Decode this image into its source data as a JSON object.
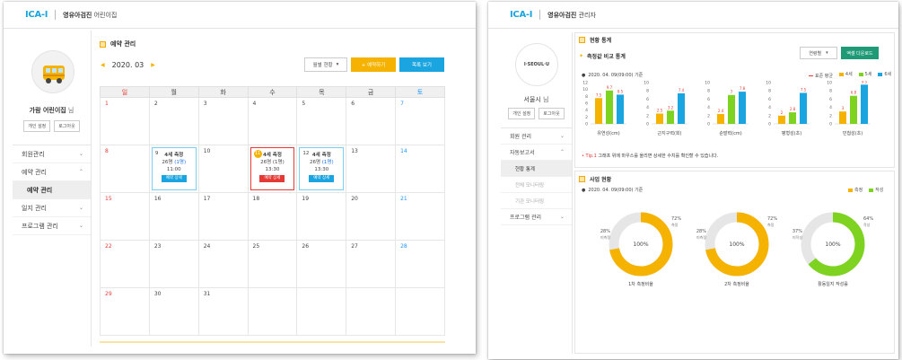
{
  "left": {
    "logo": "ICA-I",
    "title_bold": "영유아검진",
    "title_rest": " 어린이집",
    "profile": {
      "name": "가람 어린이집",
      "suffix": " 님",
      "btn1": "개인 설정",
      "btn2": "로그아웃"
    },
    "menu": [
      {
        "label": "회원관리",
        "chev": "⌄"
      },
      {
        "label": "예약 관리",
        "chev": "⌃"
      },
      {
        "label": "예약 관리",
        "chev": ""
      },
      {
        "label": "일지 관리",
        "chev": "⌄"
      },
      {
        "label": "프로그램 관리",
        "chev": "⌄"
      }
    ],
    "section_title": "예약 관리",
    "month": "2020. 03",
    "prev": "◀",
    "next": "▶",
    "select_label": "월별 현황",
    "reserve_btn": "+ 예약하기",
    "list_btn": "목록 보기",
    "weekdays": [
      "일",
      "월",
      "화",
      "수",
      "목",
      "금",
      "토"
    ],
    "weeks": [
      [
        "1",
        "2",
        "3",
        "4",
        "5",
        "6",
        "7"
      ],
      [
        "8",
        "9",
        "10",
        "11",
        "12",
        "13",
        "14"
      ],
      [
        "15",
        "16",
        "17",
        "18",
        "19",
        "20",
        "21"
      ],
      [
        "22",
        "23",
        "24",
        "25",
        "26",
        "27",
        "28"
      ],
      [
        "29",
        "30",
        "31",
        "",
        "",
        "",
        ""
      ]
    ],
    "events": {
      "e9": {
        "day": "9",
        "title": "4세 측정",
        "count_a": "26명 ",
        "count_b": "(1명)",
        "time": "11:00",
        "btn": "예약 상세"
      },
      "e11": {
        "day": "11",
        "title": "4세 측정",
        "count_a": "26명 (1명)",
        "count_b": "",
        "time": "13:30",
        "btn": "예약 상세"
      },
      "e12": {
        "day": "12",
        "title": "4세 측정",
        "count_a": "26명 ",
        "count_b": "(1명)",
        "time": "13:30",
        "btn": "예약 상세"
      }
    }
  },
  "right": {
    "logo": "ICA-I",
    "title_bold": "영유아검진",
    "title_rest": " 관리자",
    "profile": {
      "logo": "I·SEOUL·U",
      "name": "서울시",
      "suffix": " 님",
      "btn1": "개인 설정",
      "btn2": "로그아웃"
    },
    "menu": [
      {
        "label": "회원 관리",
        "chev": "⌄",
        "cls": ""
      },
      {
        "label": "자동보고서",
        "chev": "⌃",
        "cls": ""
      },
      {
        "label": "현황 통계",
        "chev": "",
        "cls": "sub"
      },
      {
        "label": "전체 모니터링",
        "chev": "",
        "cls": "sub2"
      },
      {
        "label": "기관 모니터링",
        "chev": "",
        "cls": "sub2"
      },
      {
        "label": "프로그램 관리",
        "chev": "⌄",
        "cls": ""
      }
    ],
    "section1": "현황 통계",
    "sub1": "측정값 비교 통계",
    "select1": "연령별",
    "excel_btn": "엑셀 다운로드",
    "date1": "2020. 04. 09(09:00) 기준",
    "legend": [
      "표준 평균",
      "4세",
      "5세",
      "6세"
    ],
    "tip_label": "Tip.1",
    "tip_text": "그래프 위에 마우스를 올리면 상세한 수치를 확인할 수 있습니다.",
    "section2": "사업 현황",
    "date2": "2020. 04. 09(09:00) 기준",
    "legend2": [
      "측정",
      "작성"
    ],
    "colors": {
      "std": "#e53935",
      "age4": "#f5b300",
      "age5": "#7ed321",
      "age6": "#1aa4e0",
      "excel": "#1f9a76",
      "accent": "#f5b300"
    }
  },
  "chart_data": [
    {
      "type": "bar",
      "title": "유연성(cm)",
      "categories": [
        "4세",
        "5세",
        "6세"
      ],
      "series": [
        {
          "name": "값",
          "values": [
            7.5,
            9.7,
            8.5
          ]
        }
      ],
      "ylim": [
        0,
        12
      ],
      "yticks": [
        "12",
        "10",
        "8",
        "6",
        "4",
        "2",
        "0"
      ]
    },
    {
      "type": "bar",
      "title": "근지구력(회)",
      "categories": [
        "4세",
        "5세",
        "6세"
      ],
      "series": [
        {
          "name": "값",
          "values": [
            2.5,
            3.2,
            7.4
          ]
        }
      ],
      "ylim": [
        0,
        10
      ],
      "yticks": [
        "10",
        "8",
        "6",
        "4",
        "2",
        "0"
      ]
    },
    {
      "type": "bar",
      "title": "순발력(cm)",
      "categories": [
        "4세",
        "5세",
        "6세"
      ],
      "series": [
        {
          "name": "값",
          "values": [
            2.4,
            7.0,
            7.8
          ]
        }
      ],
      "ylim": [
        0,
        10
      ],
      "yticks": [
        "10",
        "8",
        "6",
        "4",
        "2",
        "0"
      ]
    },
    {
      "type": "bar",
      "title": "평형성(초)",
      "categories": [
        "4세",
        "5세",
        "6세"
      ],
      "series": [
        {
          "name": "값",
          "values": [
            2.0,
            2.8,
            7.5
          ]
        }
      ],
      "ylim": [
        0,
        10
      ],
      "yticks": [
        "10",
        "8",
        "6",
        "4",
        "2",
        "0"
      ]
    },
    {
      "type": "bar",
      "title": "민첩성(초)",
      "categories": [
        "4세",
        "5세",
        "6세"
      ],
      "series": [
        {
          "name": "값",
          "values": [
            3.0,
            6.8,
            9.5
          ]
        }
      ],
      "ylim": [
        0,
        10
      ],
      "yticks": [
        "10",
        "8",
        "6",
        "4",
        "2",
        "0"
      ]
    },
    {
      "type": "pie",
      "title": "1차 측정비율",
      "center": "100%",
      "slices": [
        {
          "name": "측정",
          "value": 72
        },
        {
          "name": "미측정",
          "value": 28
        }
      ],
      "labels": [
        {
          "pct": "72%",
          "name": "측정"
        },
        {
          "pct": "28%",
          "name": "미측정"
        }
      ]
    },
    {
      "type": "pie",
      "title": "2차 측정비율",
      "center": "100%",
      "slices": [
        {
          "name": "측정",
          "value": 72
        },
        {
          "name": "미측정",
          "value": 28
        }
      ],
      "labels": [
        {
          "pct": "72%",
          "name": "측정"
        },
        {
          "pct": "28%",
          "name": "미측정"
        }
      ]
    },
    {
      "type": "pie",
      "title": "활동일지 작성률",
      "center": "100%",
      "slices": [
        {
          "name": "작성",
          "value": 64
        },
        {
          "name": "미작성",
          "value": 37
        }
      ],
      "labels": [
        {
          "pct": "64%",
          "name": "작성"
        },
        {
          "pct": "37%",
          "name": "미작성"
        }
      ]
    }
  ]
}
